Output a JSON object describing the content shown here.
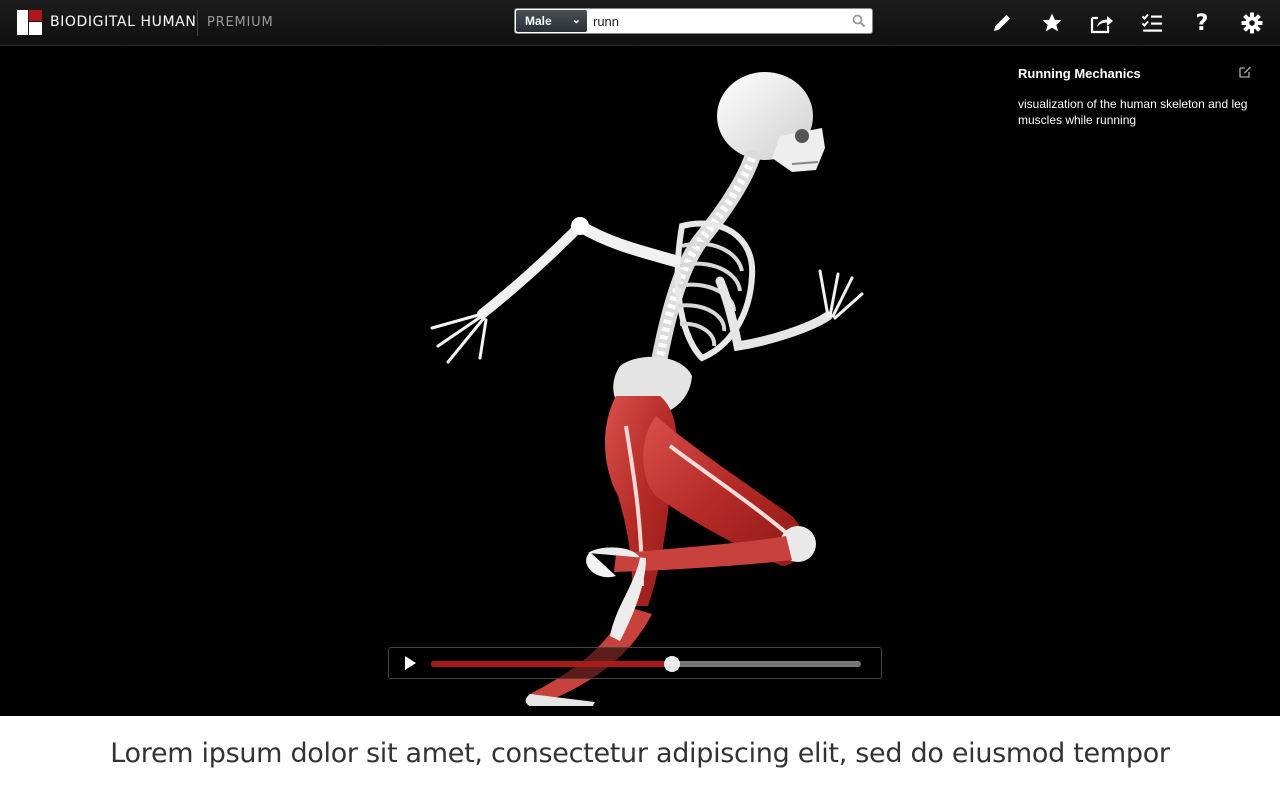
{
  "header": {
    "brand": "BIODIGITAL HUMAN",
    "tier": "PREMIUM",
    "brand_color": "#b0171b",
    "search": {
      "gender": "Male",
      "query": "runn"
    },
    "tools": [
      "pencil-icon",
      "star-icon",
      "share-icon",
      "checklist-icon",
      "help-icon",
      "gear-icon"
    ],
    "help_glyph": "?"
  },
  "info_panel": {
    "title": "Running Mechanics",
    "description": "visualization of the human skeleton and leg muscles while running"
  },
  "player": {
    "progress": 0.56,
    "progress_color": "#a61b1b"
  },
  "caption": "Lorem ipsum dolor sit amet, consectetur adipiscing elit, sed do eiusmod tempor"
}
